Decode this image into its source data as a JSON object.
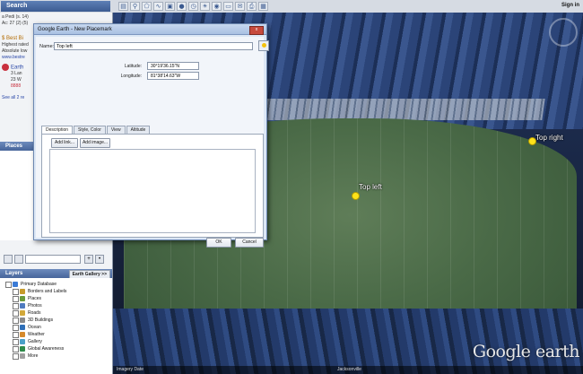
{
  "toolbar": {
    "search_title": "Search",
    "sign_in": "Sign in",
    "icons": [
      "sidebar-icon",
      "placemark-icon",
      "polygon-icon",
      "path-icon",
      "overlay-icon",
      "tour-icon",
      "history-icon",
      "sun-icon",
      "planets-icon",
      "ruler-icon",
      "email-icon",
      "print-icon",
      "maps-icon"
    ]
  },
  "sidebar": {
    "search_lines": [
      "a Pedi (s. 14)",
      "Ac: 27 (2) (5)"
    ],
    "result_title": "$ Best Bi",
    "result_lines": [
      "Highest rated",
      "Absolute low",
      "www.bestre"
    ],
    "earth_label": "Earth",
    "earth_lines": [
      "3 Lan",
      "23 W",
      "8888"
    ],
    "see_all": "See all 2 re",
    "places_title": "Places",
    "layers_title": "Layers",
    "gallery_label": "Earth Gallery >>",
    "layers": [
      {
        "label": "Primary Database",
        "color": "#3b7bd6"
      },
      {
        "label": "Borders and Labels",
        "color": "#c79b2b"
      },
      {
        "label": "Places",
        "color": "#6a9b3c"
      },
      {
        "label": "Photos",
        "color": "#4f7bc0"
      },
      {
        "label": "Roads",
        "color": "#d2a83a"
      },
      {
        "label": "3D Buildings",
        "color": "#8a8a8a"
      },
      {
        "label": "Ocean",
        "color": "#2f6fb8"
      },
      {
        "label": "Weather",
        "color": "#d68a2b"
      },
      {
        "label": "Gallery",
        "color": "#4aa0c8"
      },
      {
        "label": "Global Awareness",
        "color": "#2f8b4a"
      },
      {
        "label": "More",
        "color": "#a0a0a0"
      }
    ]
  },
  "dialog": {
    "title": "Google Earth - New Placemark",
    "close_label": "x",
    "name_label": "Name:",
    "name_value": "Top left",
    "latitude_label": "Latitude:",
    "latitude_value": "30°19'36.15\"N",
    "longitude_label": "Longitude:",
    "longitude_value": "81°38'14.63\"W",
    "tabs": [
      "Description",
      "Style, Color",
      "View",
      "Altitude"
    ],
    "add_link": "Add link...",
    "add_image": "Add image...",
    "ok": "OK",
    "cancel": "Cancel"
  },
  "map": {
    "placemark_top_left": "Top left",
    "placemark_top_right": "Top right",
    "logo": "Google earth",
    "status_left": "Imagery Date",
    "status_center": "Jacksonville"
  }
}
